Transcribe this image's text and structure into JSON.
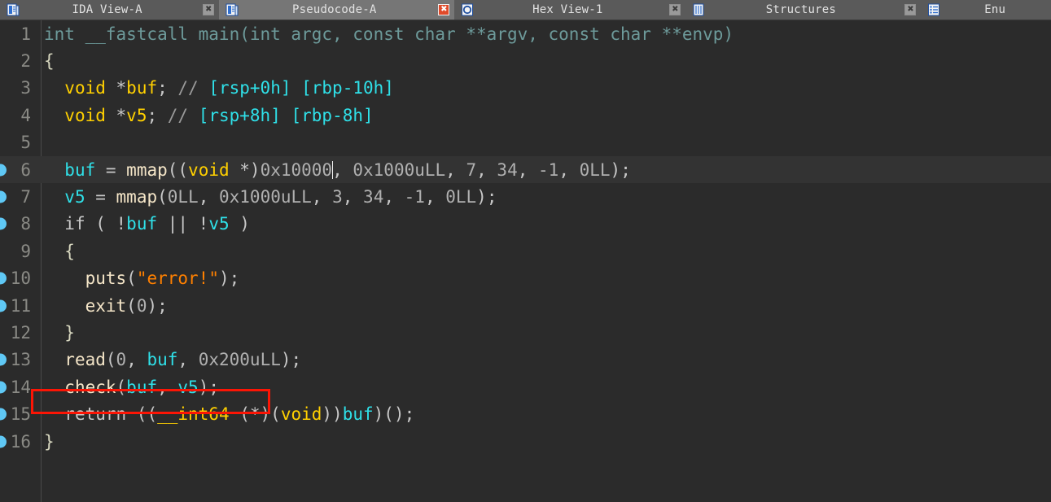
{
  "window": {
    "application": "IDA Pro",
    "active_view": "Pseudocode-A"
  },
  "tabs": [
    {
      "label": "IDA View-A",
      "icon": "document-list-icon",
      "close_label": "✖",
      "active": false
    },
    {
      "label": "Pseudocode-A",
      "icon": "document-list-icon",
      "close_label": "✖",
      "active": true
    },
    {
      "label": "Hex View-1",
      "icon": "hex-view-icon",
      "close_label": "✖",
      "active": false
    },
    {
      "label": "Structures",
      "icon": "structures-icon",
      "close_label": "✖",
      "active": false
    },
    {
      "label": "Enu",
      "icon": "enums-icon",
      "close_label": "",
      "active": false
    }
  ],
  "colors": {
    "background": "#2b2b2b",
    "current_line": "#333333",
    "tabbar": "#5a5a5a",
    "tab_active": "#767676",
    "line_number": "#8a8a85",
    "prototype": "#6d9a9a",
    "type_keyword": "#ffd000",
    "local_variable": "#2fe0e8",
    "function_name": "#f5e6c8",
    "string_literal": "#ff8000",
    "comment": "#9a9a9a",
    "number": "#b0b0b0",
    "plain_text": "#c8c8c8",
    "breakpoint_marker": "#5fc8f5",
    "annotation_box": "#fc1505"
  },
  "annotation": {
    "shape": "rectangle",
    "color": "#fc1505",
    "target_line": 14,
    "target_text": "check(buf, v5);"
  },
  "editor": {
    "current_line": 6,
    "caret_line": 6,
    "caret_after_token": "0x10000",
    "lines": [
      {
        "number": "1",
        "marker": false,
        "current": false,
        "text": "int __fastcall main(int argc, const char **argv, const char **envp)",
        "tokens": [
          {
            "t": "int __fastcall main(int argc, const char **argv, const char **envp)",
            "c": "t-proto"
          }
        ]
      },
      {
        "number": "2",
        "marker": false,
        "current": false,
        "text": "{",
        "tokens": [
          {
            "t": "{",
            "c": "t-brace"
          }
        ]
      },
      {
        "number": "3",
        "marker": false,
        "current": false,
        "text": "  void *buf; // [rsp+0h] [rbp-10h]",
        "tokens": [
          {
            "t": "  ",
            "c": "t-plain"
          },
          {
            "t": "void",
            "c": "t-type"
          },
          {
            "t": " *",
            "c": "t-plain"
          },
          {
            "t": "buf",
            "c": "t-var"
          },
          {
            "t": "; ",
            "c": "t-plain"
          },
          {
            "t": "// ",
            "c": "t-cmt"
          },
          {
            "t": "[rsp+0h] [rbp-10h]",
            "c": "t-cmtv"
          }
        ]
      },
      {
        "number": "4",
        "marker": false,
        "current": false,
        "text": "  void *v5; // [rsp+8h] [rbp-8h]",
        "tokens": [
          {
            "t": "  ",
            "c": "t-plain"
          },
          {
            "t": "void",
            "c": "t-type"
          },
          {
            "t": " *",
            "c": "t-plain"
          },
          {
            "t": "v5",
            "c": "t-var"
          },
          {
            "t": "; ",
            "c": "t-plain"
          },
          {
            "t": "// ",
            "c": "t-cmt"
          },
          {
            "t": "[rsp+8h] [rbp-8h]",
            "c": "t-cmtv"
          }
        ]
      },
      {
        "number": "5",
        "marker": false,
        "current": false,
        "text": "",
        "tokens": []
      },
      {
        "number": "6",
        "marker": true,
        "current": true,
        "text": "  buf = mmap((void *)0x10000, 0x1000uLL, 7, 34, -1, 0LL);",
        "tokens": [
          {
            "t": "  ",
            "c": "t-plain"
          },
          {
            "t": "buf",
            "c": "t-lvar"
          },
          {
            "t": " = ",
            "c": "t-plain"
          },
          {
            "t": "mmap",
            "c": "t-fn"
          },
          {
            "t": "((",
            "c": "t-plain"
          },
          {
            "t": "void",
            "c": "t-type"
          },
          {
            "t": " *)",
            "c": "t-plain"
          },
          {
            "t": "0x10000",
            "c": "t-num"
          },
          {
            "t": "CARET",
            "c": "caret"
          },
          {
            "t": ", ",
            "c": "t-plain"
          },
          {
            "t": "0x1000uLL",
            "c": "t-num"
          },
          {
            "t": ", ",
            "c": "t-plain"
          },
          {
            "t": "7",
            "c": "t-num"
          },
          {
            "t": ", ",
            "c": "t-plain"
          },
          {
            "t": "34",
            "c": "t-num"
          },
          {
            "t": ", ",
            "c": "t-plain"
          },
          {
            "t": "-1",
            "c": "t-num"
          },
          {
            "t": ", ",
            "c": "t-plain"
          },
          {
            "t": "0LL",
            "c": "t-num"
          },
          {
            "t": ");",
            "c": "t-plain"
          }
        ]
      },
      {
        "number": "7",
        "marker": true,
        "current": false,
        "text": "  v5 = mmap(0LL, 0x1000uLL, 3, 34, -1, 0LL);",
        "tokens": [
          {
            "t": "  ",
            "c": "t-plain"
          },
          {
            "t": "v5",
            "c": "t-lvar"
          },
          {
            "t": " = ",
            "c": "t-plain"
          },
          {
            "t": "mmap",
            "c": "t-fn"
          },
          {
            "t": "(",
            "c": "t-plain"
          },
          {
            "t": "0LL",
            "c": "t-num"
          },
          {
            "t": ", ",
            "c": "t-plain"
          },
          {
            "t": "0x1000uLL",
            "c": "t-num"
          },
          {
            "t": ", ",
            "c": "t-plain"
          },
          {
            "t": "3",
            "c": "t-num"
          },
          {
            "t": ", ",
            "c": "t-plain"
          },
          {
            "t": "34",
            "c": "t-num"
          },
          {
            "t": ", ",
            "c": "t-plain"
          },
          {
            "t": "-1",
            "c": "t-num"
          },
          {
            "t": ", ",
            "c": "t-plain"
          },
          {
            "t": "0LL",
            "c": "t-num"
          },
          {
            "t": ");",
            "c": "t-plain"
          }
        ]
      },
      {
        "number": "8",
        "marker": true,
        "current": false,
        "text": "  if ( !buf || !v5 )",
        "tokens": [
          {
            "t": "  ",
            "c": "t-plain"
          },
          {
            "t": "if",
            "c": "t-plain"
          },
          {
            "t": " ( !",
            "c": "t-plain"
          },
          {
            "t": "buf",
            "c": "t-lvar"
          },
          {
            "t": " || !",
            "c": "t-plain"
          },
          {
            "t": "v5",
            "c": "t-lvar"
          },
          {
            "t": " )",
            "c": "t-plain"
          }
        ]
      },
      {
        "number": "9",
        "marker": false,
        "current": false,
        "text": "  {",
        "tokens": [
          {
            "t": "  ",
            "c": "t-plain"
          },
          {
            "t": "{",
            "c": "t-brace"
          }
        ]
      },
      {
        "number": "10",
        "marker": true,
        "current": false,
        "text": "    puts(\"error!\");",
        "tokens": [
          {
            "t": "    ",
            "c": "t-plain"
          },
          {
            "t": "puts",
            "c": "t-fn"
          },
          {
            "t": "(",
            "c": "t-plain"
          },
          {
            "t": "\"error!\"",
            "c": "t-str"
          },
          {
            "t": ");",
            "c": "t-plain"
          }
        ]
      },
      {
        "number": "11",
        "marker": true,
        "current": false,
        "text": "    exit(0);",
        "tokens": [
          {
            "t": "    ",
            "c": "t-plain"
          },
          {
            "t": "exit",
            "c": "t-fn"
          },
          {
            "t": "(",
            "c": "t-plain"
          },
          {
            "t": "0",
            "c": "t-num"
          },
          {
            "t": ");",
            "c": "t-plain"
          }
        ]
      },
      {
        "number": "12",
        "marker": false,
        "current": false,
        "text": "  }",
        "tokens": [
          {
            "t": "  ",
            "c": "t-plain"
          },
          {
            "t": "}",
            "c": "t-brace"
          }
        ]
      },
      {
        "number": "13",
        "marker": true,
        "current": false,
        "text": "  read(0, buf, 0x200uLL);",
        "tokens": [
          {
            "t": "  ",
            "c": "t-plain"
          },
          {
            "t": "read",
            "c": "t-fn"
          },
          {
            "t": "(",
            "c": "t-plain"
          },
          {
            "t": "0",
            "c": "t-num"
          },
          {
            "t": ", ",
            "c": "t-plain"
          },
          {
            "t": "buf",
            "c": "t-lvar"
          },
          {
            "t": ", ",
            "c": "t-plain"
          },
          {
            "t": "0x200uLL",
            "c": "t-num"
          },
          {
            "t": ");",
            "c": "t-plain"
          }
        ]
      },
      {
        "number": "14",
        "marker": true,
        "current": false,
        "text": "  check(buf, v5);",
        "tokens": [
          {
            "t": "  ",
            "c": "t-plain"
          },
          {
            "t": "check",
            "c": "t-fn"
          },
          {
            "t": "(",
            "c": "t-plain"
          },
          {
            "t": "buf",
            "c": "t-lvar"
          },
          {
            "t": ", ",
            "c": "t-plain"
          },
          {
            "t": "v5",
            "c": "t-lvar"
          },
          {
            "t": ");",
            "c": "t-plain"
          }
        ]
      },
      {
        "number": "15",
        "marker": true,
        "current": false,
        "text": "  return ((__int64 (*)(void))buf)();",
        "tokens": [
          {
            "t": "  ",
            "c": "t-plain"
          },
          {
            "t": "return",
            "c": "t-plain"
          },
          {
            "t": " ((",
            "c": "t-plain"
          },
          {
            "t": "__int64",
            "c": "t-type"
          },
          {
            "t": " (*)(",
            "c": "t-plain"
          },
          {
            "t": "void",
            "c": "t-type"
          },
          {
            "t": "))",
            "c": "t-plain"
          },
          {
            "t": "buf",
            "c": "t-lvar"
          },
          {
            "t": ")();",
            "c": "t-plain"
          }
        ]
      },
      {
        "number": "16",
        "marker": true,
        "current": false,
        "text": "}",
        "tokens": [
          {
            "t": "}",
            "c": "t-brace"
          }
        ]
      }
    ]
  }
}
